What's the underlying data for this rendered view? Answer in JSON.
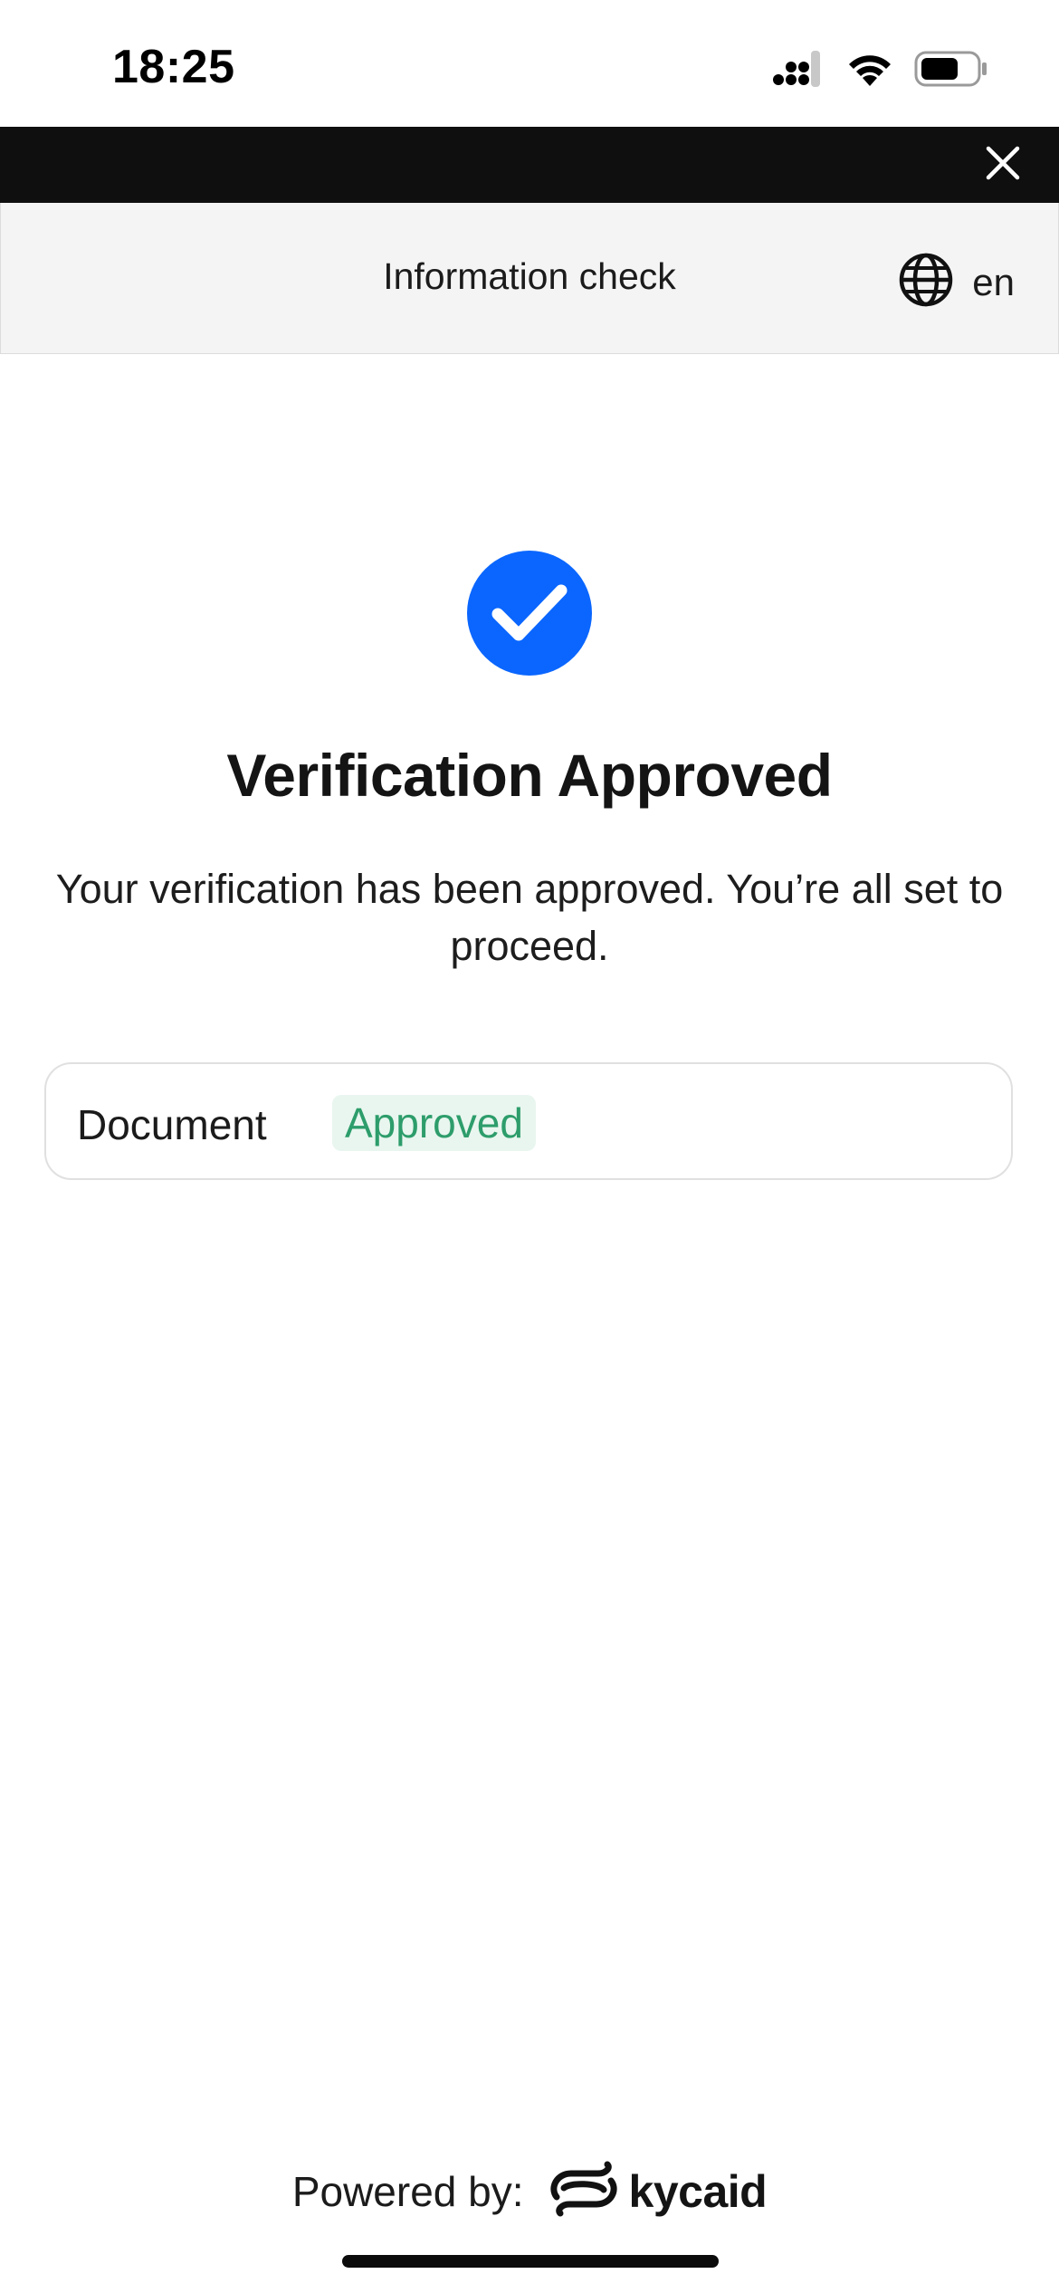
{
  "status_bar": {
    "time": "18:25",
    "icons": [
      "cellular-signal-icon",
      "wifi-icon",
      "battery-icon"
    ]
  },
  "top_bar": {
    "close_icon": "close-icon",
    "background": "#0f0f0f"
  },
  "header": {
    "title": "Information check",
    "language": "en",
    "language_icon": "globe-icon"
  },
  "main": {
    "status_icon": "checkmark-circle-icon",
    "accent_color": "#0a66ff",
    "title": "Verification Approved",
    "description": "Your verification has been approved. You’re all set to proceed.",
    "items": [
      {
        "label": "Document",
        "status": "Approved",
        "status_color": "#2d9d6b"
      }
    ]
  },
  "footer": {
    "powered_by": "Powered by:",
    "brand": "kycaid",
    "brand_icon": "kycaid-logo-icon"
  }
}
